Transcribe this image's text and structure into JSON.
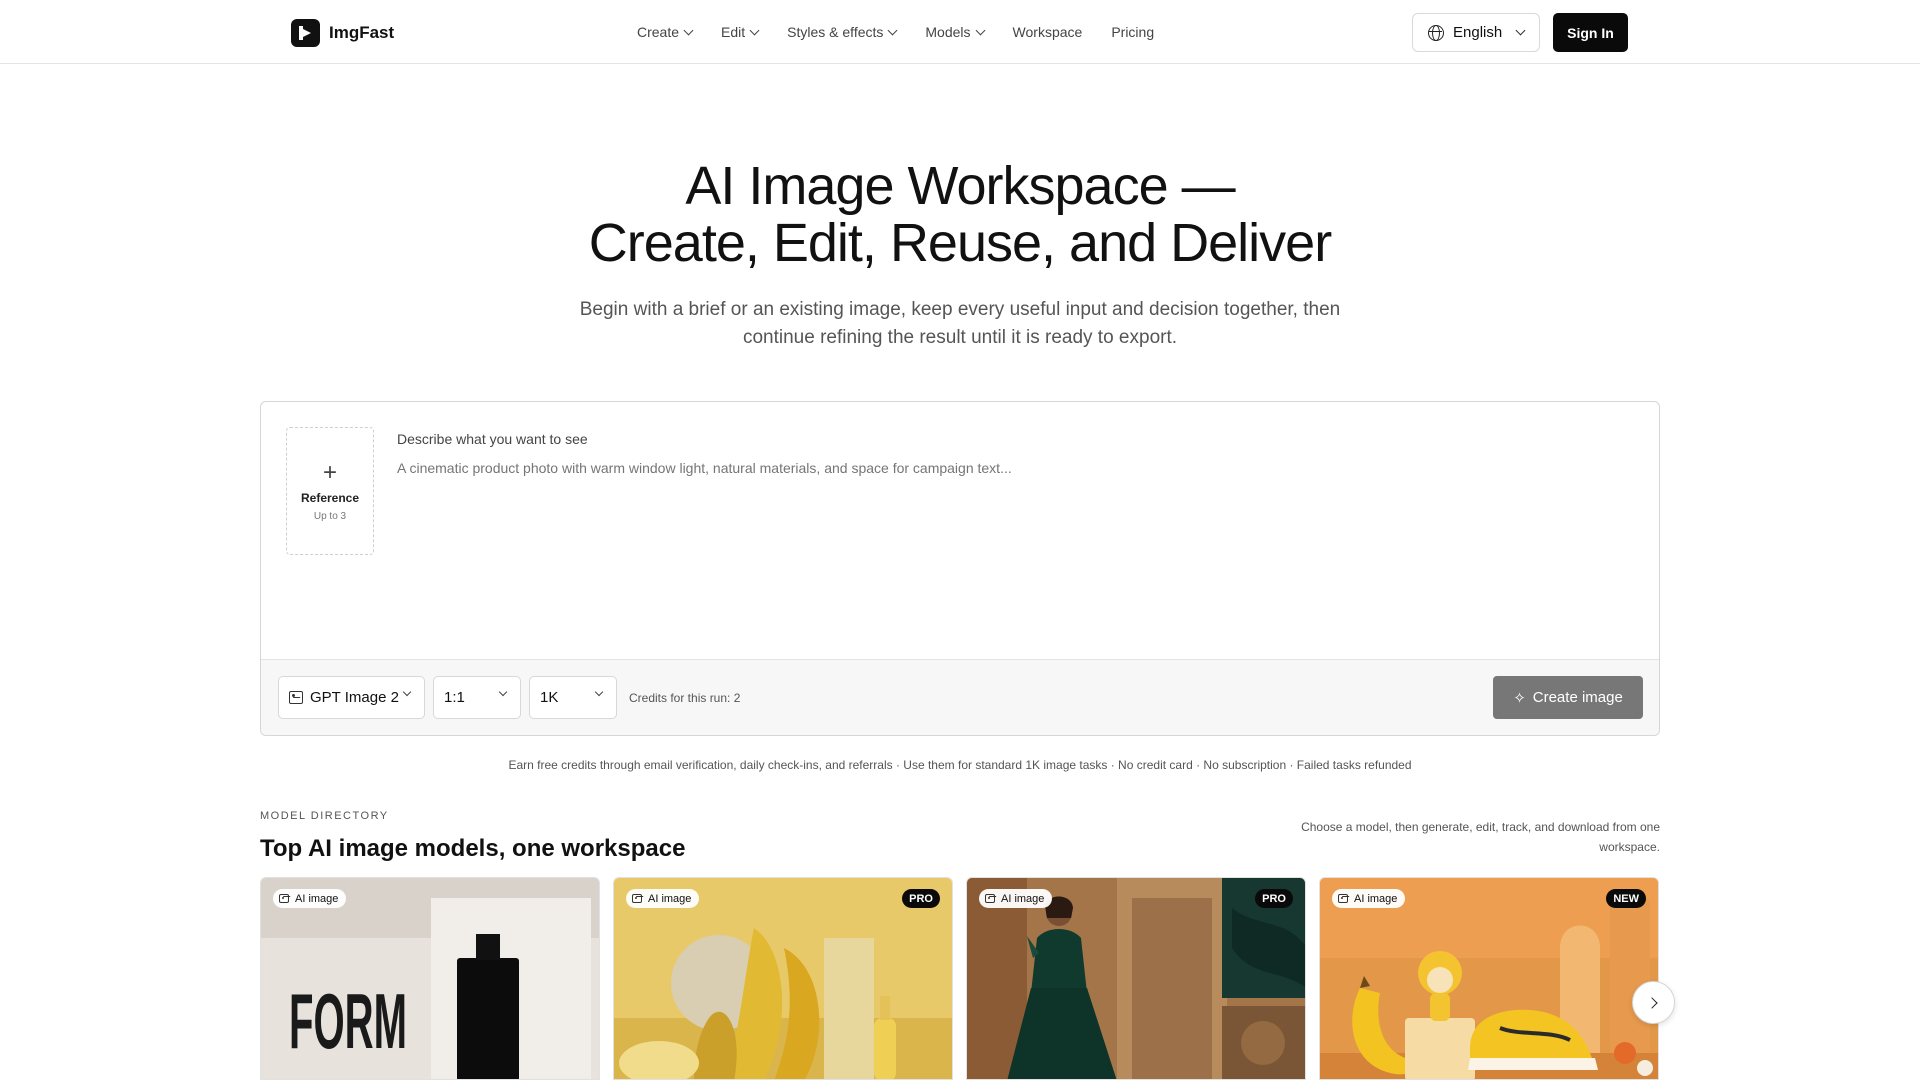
{
  "header": {
    "brand": "ImgFast",
    "nav": [
      {
        "label": "Create",
        "has_dropdown": true
      },
      {
        "label": "Edit",
        "has_dropdown": true
      },
      {
        "label": "Styles & effects",
        "has_dropdown": true
      },
      {
        "label": "Models",
        "has_dropdown": true
      },
      {
        "label": "Workspace",
        "has_dropdown": false
      },
      {
        "label": "Pricing",
        "has_dropdown": false
      }
    ],
    "language": "English",
    "sign_in": "Sign In"
  },
  "hero": {
    "title_line1": "AI Image Workspace —",
    "title_line2": "Create, Edit, Reuse, and Deliver",
    "subtitle": "Begin with a brief or an existing image, keep every useful input and decision together, then continue refining the result until it is ready to export."
  },
  "composer": {
    "reference_label": "Reference",
    "reference_sub": "Up to 3",
    "prompt_label": "Describe what you want to see",
    "prompt_placeholder": "A cinematic product photo with warm window light, natural materials, and space for campaign text...",
    "model": "GPT Image 2",
    "aspect_ratio": "1:1",
    "resolution": "1K",
    "credits_run": "Credits for this run: 2",
    "create_button": "Create image"
  },
  "free_credits": "Earn free credits through email verification, daily check-ins, and referrals · Use them for standard 1K image tasks · No credit card · No subscription · Failed tasks refunded",
  "directory": {
    "kicker": "MODEL DIRECTORY",
    "title": "Top AI image models, one workspace",
    "description": "Choose a model, then generate, edit, track, and download from one workspace.",
    "cards": [
      {
        "tag": "AI image",
        "badge": "",
        "art_text": "FORM"
      },
      {
        "tag": "AI image",
        "badge": "PRO"
      },
      {
        "tag": "AI image",
        "badge": "PRO"
      },
      {
        "tag": "AI image",
        "badge": "NEW"
      }
    ]
  },
  "icons": {
    "logo": "imgfast-logo-icon",
    "globe": "globe-icon",
    "image": "image-icon",
    "sparkle": "sparkle-icon",
    "next": "chevron-right-icon"
  }
}
